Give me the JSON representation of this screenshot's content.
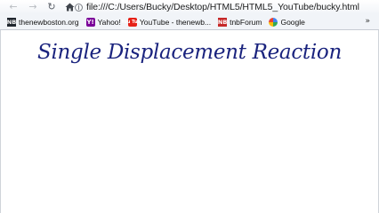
{
  "toolbar": {
    "back_icon": "arrow-left-icon",
    "forward_icon": "arrow-right-icon",
    "reload_icon": "reload-icon",
    "home_icon": "home-icon",
    "url": "file:///C:/Users/Bucky/Desktop/HTML5/HTML5_YouTube/bucky.html"
  },
  "bookmarks": [
    {
      "label": "thenewboston.org",
      "icon": "NB"
    },
    {
      "label": "Yahoo!",
      "icon": "Y!"
    },
    {
      "label": "YouTube - thenewb...",
      "icon": "You Tube"
    },
    {
      "label": "tnbForum",
      "icon": "NB"
    },
    {
      "label": "Google",
      "icon": "google-icon"
    }
  ],
  "page": {
    "heading": "Single Displacement Reaction"
  }
}
